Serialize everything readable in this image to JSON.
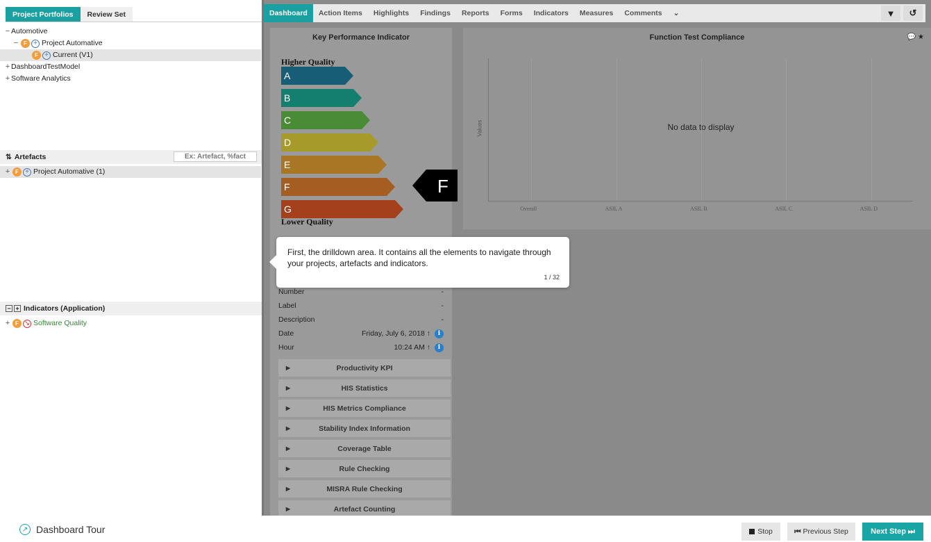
{
  "left": {
    "tabs": [
      "Project Portfolios",
      "Review Set"
    ],
    "tree": [
      {
        "expander": "−",
        "label": "Automotive",
        "badge": false
      },
      {
        "expander": "−",
        "label": "Project Automative",
        "badge": true
      },
      {
        "expander": "",
        "label": "Current (V1)",
        "badge": true
      },
      {
        "expander": "+",
        "label": "DashboardTestModel",
        "badge": false
      },
      {
        "expander": "+",
        "label": "Software Analytics",
        "badge": false
      }
    ],
    "artefacts": {
      "title": "Artefacts",
      "search_placeholder": "Ex: Artefact, %fact",
      "item": "Project Automative (1)"
    },
    "indicators": {
      "title": "Indicators (Application)",
      "item": "Software Quality"
    }
  },
  "nav": {
    "tabs": [
      "Dashboard",
      "Action Items",
      "Highlights",
      "Findings",
      "Reports",
      "Forms",
      "Indicators",
      "Measures",
      "Comments",
      "⌄"
    ],
    "icons": [
      "filter-icon",
      "history-icon"
    ]
  },
  "kpi": {
    "title": "Key Performance Indicator",
    "higher": "Higher Quality",
    "lower": "Lower Quality",
    "grades": [
      {
        "letter": "A",
        "color": "#175d76"
      },
      {
        "letter": "B",
        "color": "#157f6f"
      },
      {
        "letter": "C",
        "color": "#4a8c35"
      },
      {
        "letter": "D",
        "color": "#a59a2a"
      },
      {
        "letter": "E",
        "color": "#a87624"
      },
      {
        "letter": "F",
        "color": "#a55e22"
      },
      {
        "letter": "G",
        "color": "#a5401c"
      }
    ],
    "current_grade": "F",
    "info": [
      {
        "label": "Number",
        "value": "-"
      },
      {
        "label": "Label",
        "value": "-"
      },
      {
        "label": "Description",
        "value": "-"
      },
      {
        "label": "Date",
        "value": "Friday, July 6, 2018 ↑"
      },
      {
        "label": "Hour",
        "value": "10:24 AM ↑"
      }
    ],
    "sections": [
      "Productivity KPI",
      "HIS Statistics",
      "HIS Metrics Compliance",
      "Stability Index Information",
      "Coverage Table",
      "Rule Checking",
      "MISRA Rule Checking",
      "Artefact Counting"
    ]
  },
  "chart_data": {
    "type": "bar",
    "title": "Function Test Compliance",
    "ylabel": "Values",
    "categories": [
      "Overall",
      "ASIL A",
      "ASIL B",
      "ASIL C",
      "ASIL D"
    ],
    "series": [],
    "empty_message": "No data to display"
  },
  "tooltip": {
    "message": "First, the drilldown area. It contains all the elements to navigate through your projects, artefacts and indicators.",
    "step": "1 / 32"
  },
  "footer": {
    "tour": "Dashboard Tour",
    "stop": "Stop",
    "prev": "Previous Step",
    "next": "Next Step"
  }
}
